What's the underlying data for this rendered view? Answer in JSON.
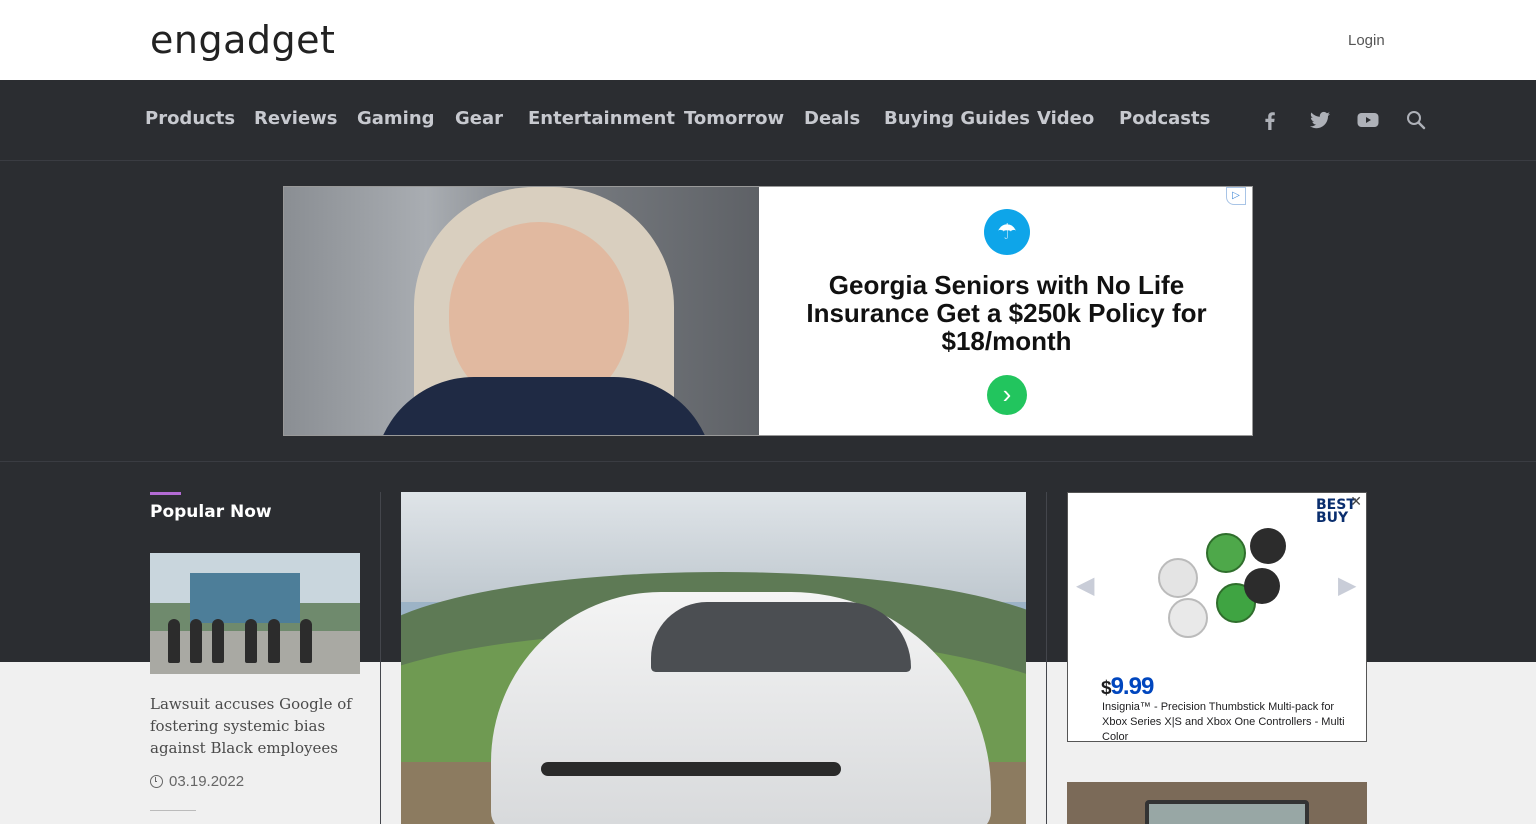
{
  "header": {
    "logo_text": "engadget",
    "login_label": "Login"
  },
  "nav": {
    "items": [
      "Products",
      "Reviews",
      "Gaming",
      "Gear",
      "Entertainment",
      "Tomorrow",
      "Deals",
      "Buying Guides",
      "Video",
      "Podcasts"
    ],
    "icons": [
      "facebook-icon",
      "twitter-icon",
      "youtube-icon",
      "search-icon"
    ]
  },
  "ad_banner": {
    "headline": "Georgia Seniors with No Life Insurance Get a $250k Policy for $18/month",
    "accent_color": "#0ea5e9",
    "cta_color": "#22c55e"
  },
  "popular": {
    "heading": "Popular Now",
    "story": {
      "title": "Lawsuit accuses Google of fostering systemic bias against Black employees",
      "date": "03.19.2022"
    }
  },
  "side_ad": {
    "brand": "BEST BUY",
    "price_currency": "$",
    "price_value": "9.99",
    "description": "Insignia™ - Precision Thumbstick Multi-pack for Xbox Series X|S and Xbox One Controllers - Multi Color"
  },
  "colors": {
    "nav_bg": "#2b2d31",
    "nav_text": "#c7c9cf",
    "accent_purple": "#b36bd4",
    "price_blue": "#0046be"
  }
}
